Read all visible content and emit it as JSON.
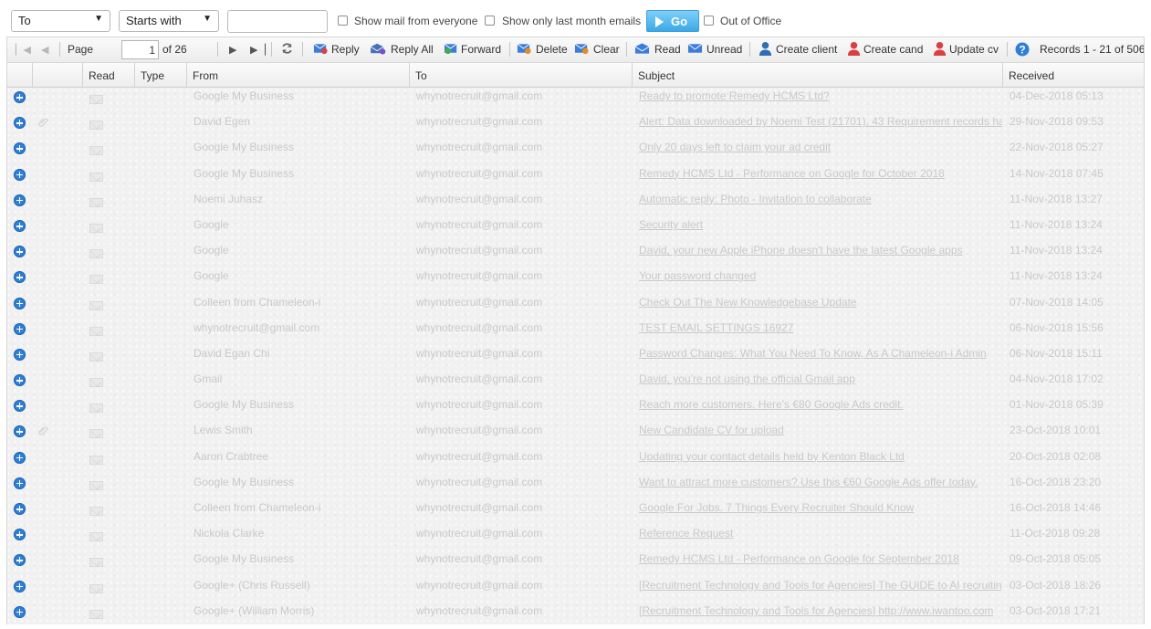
{
  "filters": {
    "field_select": "To",
    "operator_select": "Starts with",
    "search_value": "",
    "show_everyone_label": "Show mail from everyone",
    "last_month_label": "Show only last month emails",
    "go_label": "Go",
    "out_of_office_label": "Out of Office"
  },
  "toolbar": {
    "page_label": "Page",
    "page_value": "1",
    "page_of": "of 26",
    "reply": "Reply",
    "reply_all": "Reply All",
    "forward": "Forward",
    "delete": "Delete",
    "clear": "Clear",
    "read": "Read",
    "unread": "Unread",
    "create_client": "Create client",
    "create_cand": "Create cand",
    "update_cv": "Update cv",
    "records": "Records 1 - 21 of 506"
  },
  "columns": [
    "Read",
    "Type",
    "From",
    "To",
    "Subject",
    "Received"
  ],
  "colors": {
    "accent": "#2f7fd6",
    "go_button": "#3ba8e6",
    "person_red": "#d94040",
    "person_blue": "#2f6db5"
  },
  "emails": [
    {
      "from": "Google My Business",
      "to": "whynotrecruit@gmail.com",
      "subject": "Ready to promote Remedy HCMS Ltd?",
      "received": "04-Dec-2018 05:13",
      "attachment": false
    },
    {
      "from": "David Egen",
      "to": "whynotrecruit@gmail.com",
      "subject": "Alert: Data downloaded by Noemi Test (21701). 43 Requirement records have been downloaded",
      "received": "29-Nov-2018 09:53",
      "attachment": true
    },
    {
      "from": "Google My Business",
      "to": "whynotrecruit@gmail.com",
      "subject": "Only 20 days left to claim your ad credit",
      "received": "22-Nov-2018 05:27",
      "attachment": false
    },
    {
      "from": "Google My Business",
      "to": "whynotrecruit@gmail.com",
      "subject": "Remedy HCMS Ltd - Performance on Google for October 2018",
      "received": "14-Nov-2018 07:45",
      "attachment": false
    },
    {
      "from": "Noemi Juhasz",
      "to": "whynotrecruit@gmail.com",
      "subject": "Automatic reply: Photo - Invitation to collaborate",
      "received": "11-Nov-2018 13:27",
      "attachment": false
    },
    {
      "from": "Google",
      "to": "whynotrecruit@gmail.com",
      "subject": "Security alert",
      "received": "11-Nov-2018 13:24",
      "attachment": false
    },
    {
      "from": "Google",
      "to": "whynotrecruit@gmail.com",
      "subject": "David, your new Apple iPhone doesn't have the latest Google apps",
      "received": "11-Nov-2018 13:24",
      "attachment": false
    },
    {
      "from": "Google",
      "to": "whynotrecruit@gmail.com",
      "subject": "Your password changed",
      "received": "11-Nov-2018 13:24",
      "attachment": false
    },
    {
      "from": "Colleen from Chameleon-i",
      "to": "whynotrecruit@gmail.com",
      "subject": "Check Out The New Knowledgebase Update",
      "received": "07-Nov-2018 14:05",
      "attachment": false
    },
    {
      "from": "whynotrecruit@gmail.com",
      "to": "whynotrecruit@gmail.com",
      "subject": "TEST EMAIL SETTINGS 16927",
      "received": "06-Nov-2018 15:56",
      "attachment": false
    },
    {
      "from": "David Egan Chi",
      "to": "whynotrecruit@gmail.com",
      "subject": "Password Changes: What You Need To Know, As A Chameleon-i Admin",
      "received": "06-Nov-2018 15:11",
      "attachment": false
    },
    {
      "from": "Gmail",
      "to": "whynotrecruit@gmail.com",
      "subject": "David, you're not using the official Gmail app",
      "received": "04-Nov-2018 17:02",
      "attachment": false
    },
    {
      "from": "Google My Business",
      "to": "whynotrecruit@gmail.com",
      "subject": "Reach more customers. Here's €80 Google Ads credit.",
      "received": "01-Nov-2018 05:39",
      "attachment": false
    },
    {
      "from": "Lewis Smith",
      "to": "whynotrecruit@gmail.com",
      "subject": "New Candidate CV for upload",
      "received": "23-Oct-2018 10:01",
      "attachment": true
    },
    {
      "from": "Aaron Crabtree",
      "to": "whynotrecruit@gmail.com",
      "subject": "Updating your contact details held by Kenton Black Ltd",
      "received": "20-Oct-2018 02:08",
      "attachment": false
    },
    {
      "from": "Google My Business",
      "to": "whynotrecruit@gmail.com",
      "subject": "Want to attract more customers? Use this €60 Google Ads offer today.",
      "received": "16-Oct-2018 23:20",
      "attachment": false
    },
    {
      "from": "Colleen from Chameleon-i",
      "to": "whynotrecruit@gmail.com",
      "subject": "Google For Jobs. 7 Things Every Recruiter Should Know",
      "received": "16-Oct-2018 14:46",
      "attachment": false
    },
    {
      "from": "Nickola Clarke",
      "to": "whynotrecruit@gmail.com",
      "subject": "Reference Request",
      "received": "11-Oct-2018 09:28",
      "attachment": false
    },
    {
      "from": "Google My Business",
      "to": "whynotrecruit@gmail.com",
      "subject": "Remedy HCMS Ltd - Performance on Google for September 2018",
      "received": "09-Oct-2018 05:05",
      "attachment": false
    },
    {
      "from": "Google+ (Chris Russell)",
      "to": "whynotrecruit@gmail.com",
      "subject": "[Recruitment Technology and Tools for Agencies] The GUIDE to AI recruiting",
      "received": "03-Oct-2018 18:26",
      "attachment": false
    },
    {
      "from": "Google+ (William Morris)",
      "to": "whynotrecruit@gmail.com",
      "subject": "[Recruitment Technology and Tools for Agencies] http://www.iwantoo.com",
      "received": "03-Oct-2018 17:21",
      "attachment": false
    }
  ]
}
